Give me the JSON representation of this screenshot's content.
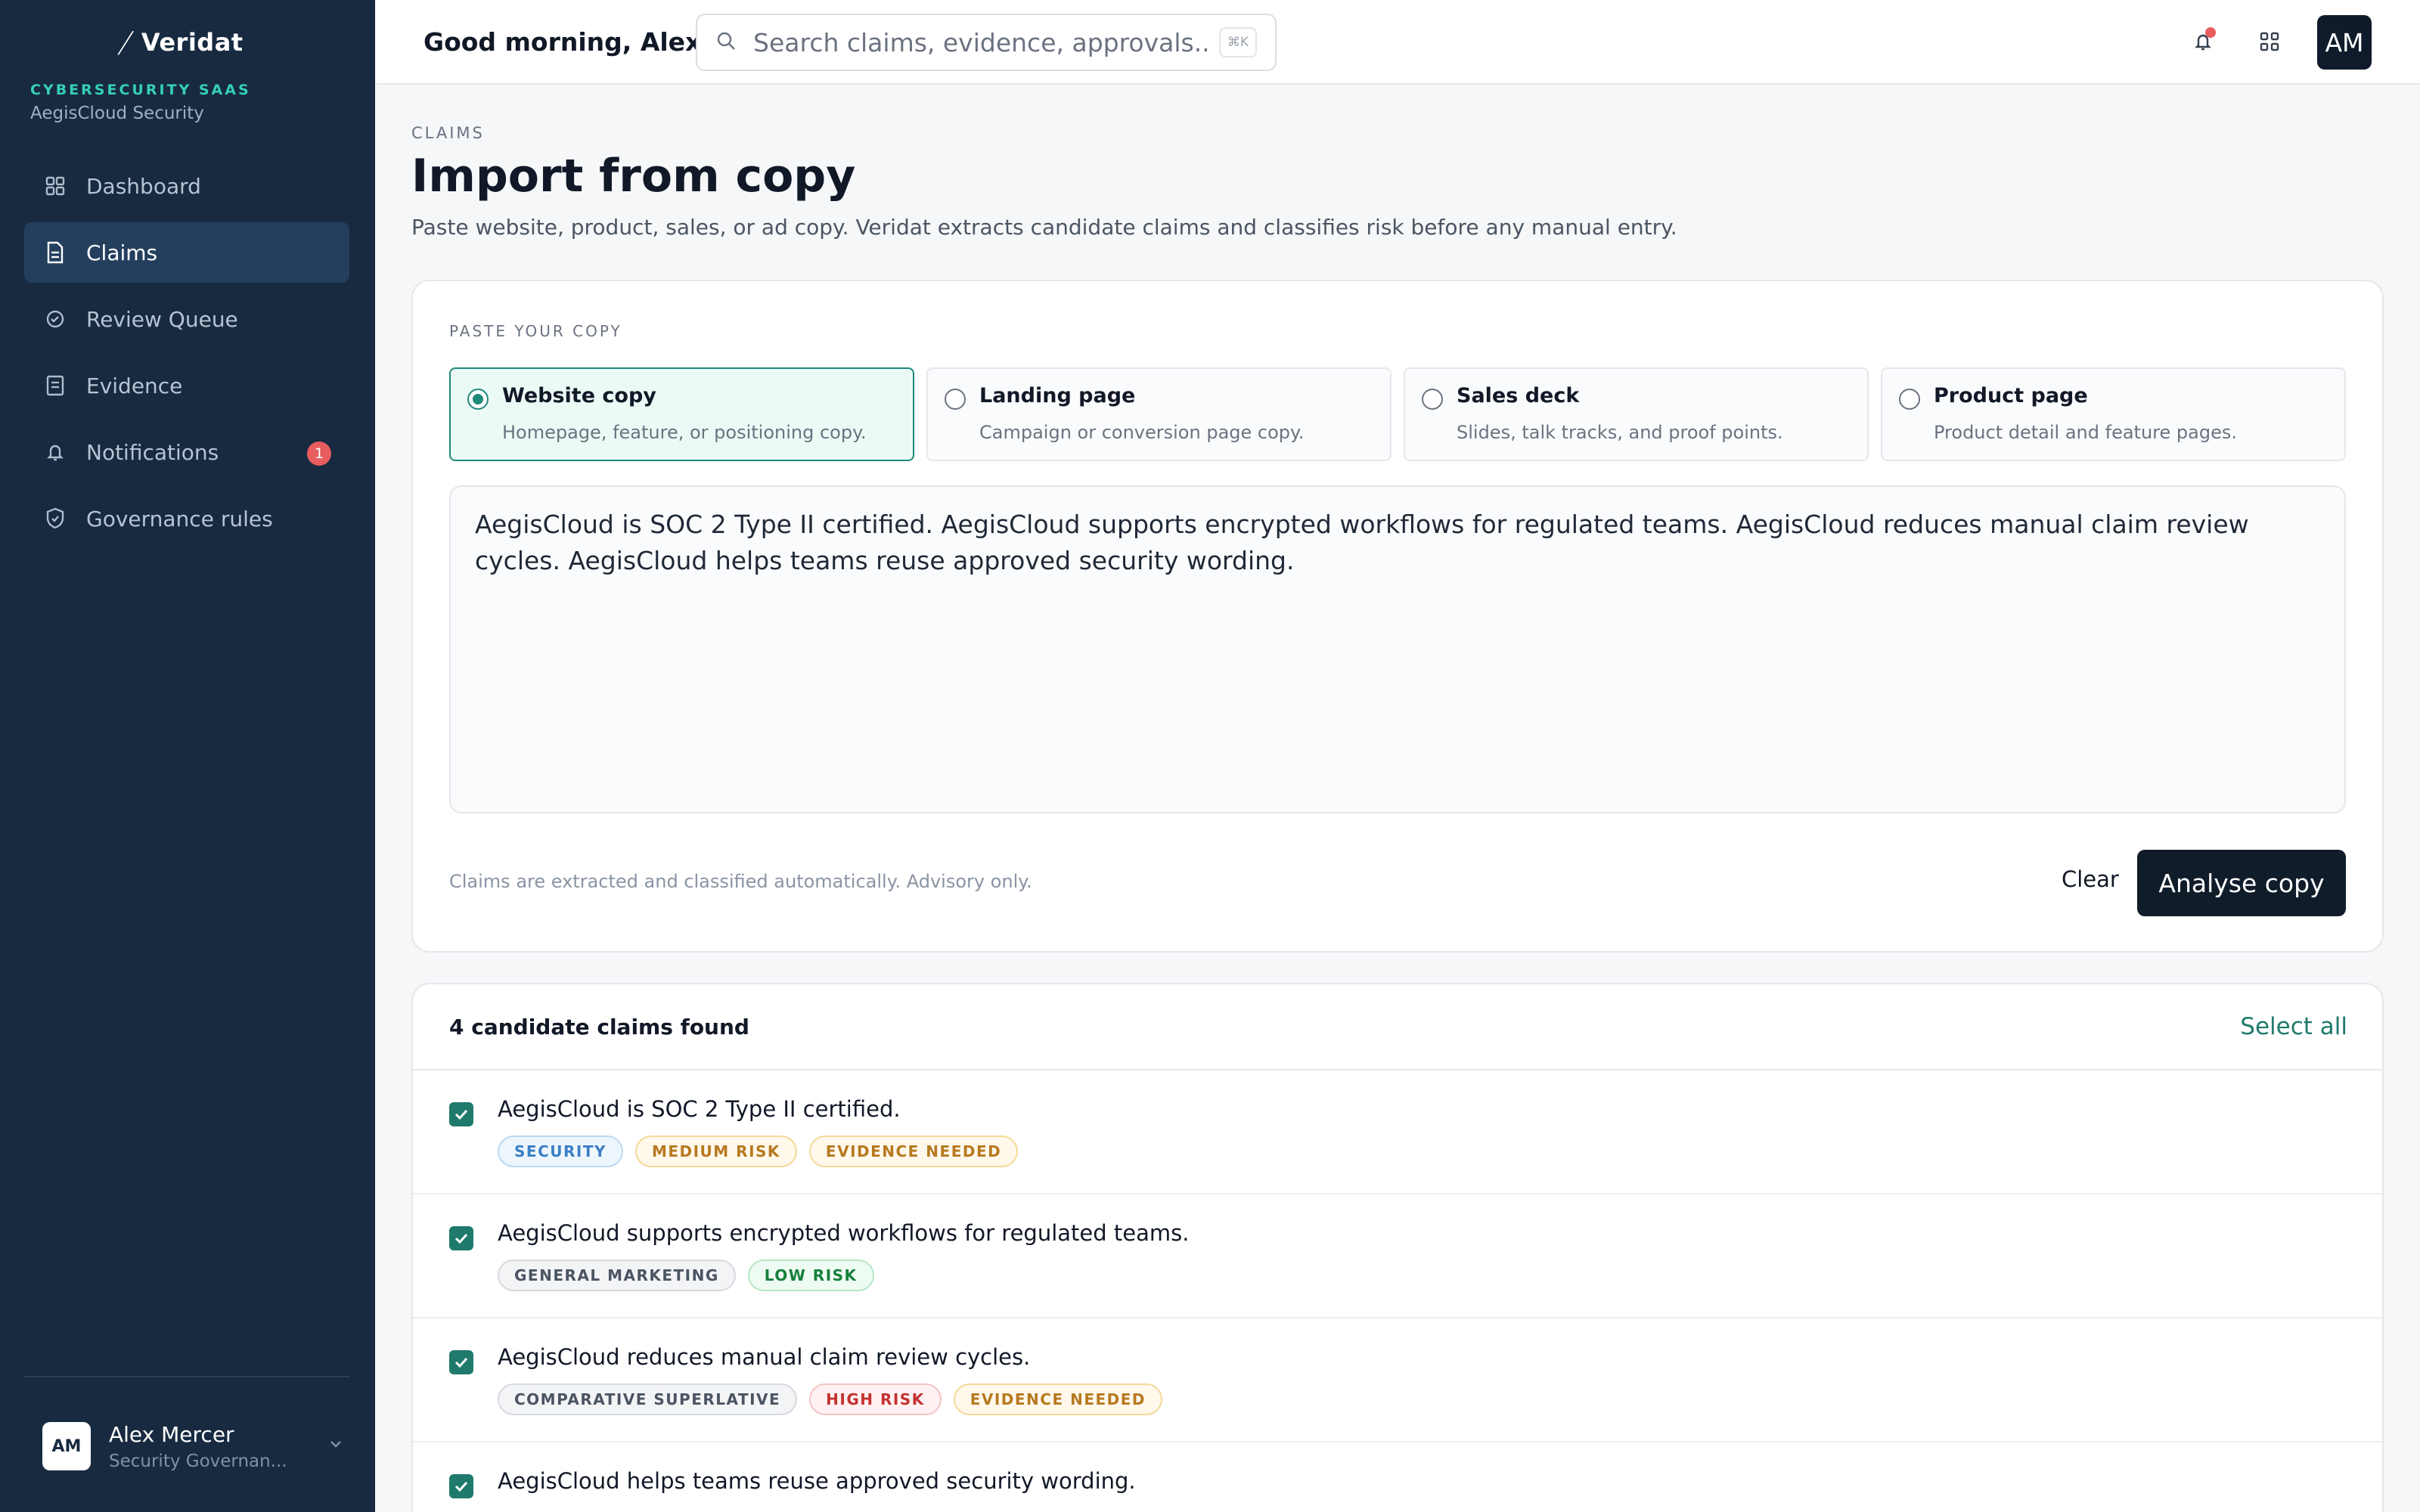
{
  "sidebar": {
    "brand": "Veridat",
    "org_kicker": "CYBERSECURITY SAAS",
    "org_name": "AegisCloud Security",
    "items": [
      {
        "label": "Dashboard",
        "icon": "dashboard-grid-icon",
        "active": false
      },
      {
        "label": "Claims",
        "icon": "document-icon",
        "active": true
      },
      {
        "label": "Review Queue",
        "icon": "review-icon",
        "active": false
      },
      {
        "label": "Evidence",
        "icon": "evidence-icon",
        "active": false
      },
      {
        "label": "Notifications",
        "icon": "bell-icon",
        "active": false,
        "badge": "1"
      },
      {
        "label": "Governance rules",
        "icon": "shield-icon",
        "active": false
      }
    ],
    "user": {
      "initials": "AM",
      "name": "Alex Mercer",
      "role": "Security Governan..."
    }
  },
  "topbar": {
    "greeting": "Good morning, Alex",
    "search_placeholder": "Search claims, evidence, approvals...",
    "shortcut": "⌘K",
    "avatar_initials": "AM"
  },
  "page": {
    "kicker": "CLAIMS",
    "title": "Import from copy",
    "subtitle": "Paste website, product, sales, or ad copy. Veridat extracts candidate claims and classifies risk before any manual entry."
  },
  "paste_card": {
    "kicker": "PASTE YOUR COPY",
    "options": [
      {
        "title": "Website copy",
        "desc": "Homepage, feature, or positioning copy.",
        "selected": true
      },
      {
        "title": "Landing page",
        "desc": "Campaign or conversion page copy.",
        "selected": false
      },
      {
        "title": "Sales deck",
        "desc": "Slides, talk tracks, and proof points.",
        "selected": false
      },
      {
        "title": "Product page",
        "desc": "Product detail and feature pages.",
        "selected": false
      }
    ],
    "copy_text": "AegisCloud is SOC 2 Type II certified. AegisCloud supports encrypted workflows for regulated teams. AegisCloud reduces manual claim review cycles. AegisCloud helps teams reuse approved security wording.",
    "footnote": "Claims are extracted and classified automatically. Advisory only.",
    "clear_label": "Clear",
    "analyse_label": "Analyse copy"
  },
  "results": {
    "found_label": "4 candidate claims found",
    "select_all_label": "Select all",
    "claims": [
      {
        "text": "AegisCloud is SOC 2 Type II certified.",
        "checked": true,
        "tags": [
          {
            "label": "SECURITY",
            "style": "blue"
          },
          {
            "label": "MEDIUM RISK",
            "style": "amber"
          },
          {
            "label": "EVIDENCE NEEDED",
            "style": "amber"
          }
        ]
      },
      {
        "text": "AegisCloud supports encrypted workflows for regulated teams.",
        "checked": true,
        "tags": [
          {
            "label": "GENERAL MARKETING",
            "style": "gray"
          },
          {
            "label": "LOW RISK",
            "style": "green"
          }
        ]
      },
      {
        "text": "AegisCloud reduces manual claim review cycles.",
        "checked": true,
        "tags": [
          {
            "label": "COMPARATIVE SUPERLATIVE",
            "style": "gray"
          },
          {
            "label": "HIGH RISK",
            "style": "red"
          },
          {
            "label": "EVIDENCE NEEDED",
            "style": "amber"
          }
        ]
      },
      {
        "text": "AegisCloud helps teams reuse approved security wording.",
        "checked": true,
        "tags": []
      }
    ]
  },
  "colors": {
    "sidebar_bg": "#172a40",
    "accent": "#1f7a6c",
    "primary_button": "#111c2b",
    "badge": "#e85d5d"
  }
}
